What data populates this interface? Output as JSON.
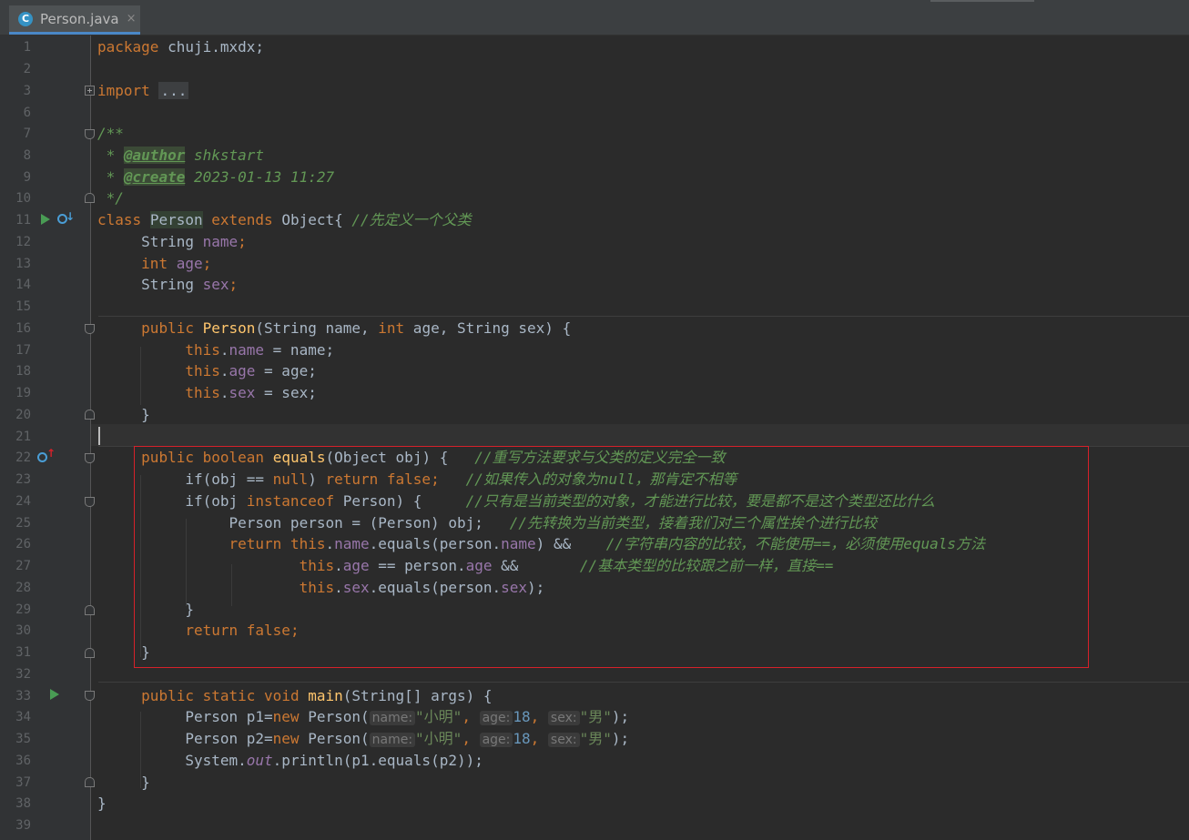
{
  "tab": {
    "title": "Person.java",
    "icon_letter": "C",
    "close_label": "×"
  },
  "colors": {
    "keyword": "#cc7832",
    "field": "#9876aa",
    "string": "#6a8759",
    "number": "#6897bb",
    "method": "#ffc66d",
    "comment": "#629755",
    "text": "#a9b7c6",
    "highlight_box": "#d6212a"
  },
  "icons": {
    "run": "run-triangle-icon",
    "override": "overridden-method-icon",
    "implements": "overriding-method-icon"
  },
  "line_numbers": [
    "1",
    "2",
    "3",
    "6",
    "7",
    "8",
    "9",
    "10",
    "11",
    "12",
    "13",
    "14",
    "15",
    "16",
    "17",
    "18",
    "19",
    "20",
    "21",
    "22",
    "23",
    "24",
    "25",
    "26",
    "27",
    "28",
    "29",
    "30",
    "31",
    "32",
    "33",
    "34",
    "35",
    "36",
    "37",
    "38",
    "39"
  ],
  "code": {
    "l1": {
      "kw": "package",
      "rest": " chuji.mxdx;"
    },
    "l3": {
      "kw": "import",
      "folded": "..."
    },
    "l7": {
      "c": "/**"
    },
    "l8": {
      "pre": " * ",
      "tag": "@author",
      "rest": " shkstart"
    },
    "l9": {
      "pre": " * ",
      "tag": "@create",
      "rest": " 2023-01-13 11:27"
    },
    "l10": {
      "c": " */"
    },
    "l11": {
      "kw1": "class",
      "name": "Person",
      "kw2": "extends",
      "rest": " Object{ ",
      "cmt": "//先定义一个父类"
    },
    "l12": {
      "type": "String",
      "field": "name",
      "end": ";"
    },
    "l13": {
      "type": "int",
      "field": "age",
      "end": ";"
    },
    "l14": {
      "type": "String",
      "field": "sex",
      "end": ";"
    },
    "l16": {
      "kw": "public",
      "fn": "Person",
      "p1": "(String name, ",
      "int": "int",
      "p2": " age, String sex) {"
    },
    "l17": {
      "this": "this",
      "dot": ".",
      "f": "name",
      "rest": " = name;"
    },
    "l18": {
      "this": "this",
      "dot": ".",
      "f": "age",
      "rest": " = age;"
    },
    "l19": {
      "this": "this",
      "dot": ".",
      "f": "sex",
      "rest": " = sex;"
    },
    "l20": {
      "t": "}"
    },
    "l22": {
      "kw1": "public",
      "kw2": "boolean",
      "fn": "equals",
      "rest": "(Object obj) {",
      "cmt": "//重写方法要求与父类的定义完全一致"
    },
    "l23": {
      "a": "if(obj == ",
      "null": "null",
      "b": ") ",
      "ret": "return",
      "false": "false",
      "end": ";",
      "cmt": "//如果传入的对象为null，那肯定不相等"
    },
    "l24": {
      "a": "if(obj ",
      "inst": "instanceof",
      "b": " Person) {",
      "cmt": "//只有是当前类型的对象，才能进行比较，要是都不是这个类型还比什么"
    },
    "l25": {
      "a": "Person person = (Person) obj;",
      "cmt": "//先转换为当前类型，接着我们对三个属性挨个进行比较"
    },
    "l26": {
      "ret": "return",
      "this": "this",
      "d1": ".",
      "f1": "name",
      "mid": ".equals(person.",
      "f2": "name",
      "end": ") &&",
      "cmt": "//字符串内容的比较，不能使用==，必须使用equals方法"
    },
    "l27": {
      "this": "this",
      "d1": ".",
      "f1": "age",
      "mid": " == person.",
      "f2": "age",
      "end": " &&",
      "cmt": "//基本类型的比较跟之前一样，直接=="
    },
    "l28": {
      "this": "this",
      "d1": ".",
      "f1": "sex",
      "mid": ".equals(person.",
      "f2": "sex",
      "end": ");"
    },
    "l29": {
      "t": "}"
    },
    "l30": {
      "ret": "return",
      "false": "false",
      "end": ";"
    },
    "l31": {
      "t": "}"
    },
    "l33": {
      "kw1": "public",
      "kw2": "static",
      "kw3": "void",
      "fn": "main",
      "rest": "(String[] args) {"
    },
    "l34": {
      "a": "Person p1=",
      "new": "new",
      "b": " Person(",
      "h1": "name:",
      "s1": "\"小明\"",
      "c1": ", ",
      "h2": "age:",
      "n": "18",
      "c2": ", ",
      "h3": "sex:",
      "s2": "\"男\"",
      "end": ");"
    },
    "l35": {
      "a": "Person p2=",
      "new": "new",
      "b": " Person(",
      "h1": "name:",
      "s1": "\"小明\"",
      "c1": ", ",
      "h2": "age:",
      "n": "18",
      "c2": ", ",
      "h3": "sex:",
      "s2": "\"男\"",
      "end": ");"
    },
    "l36": {
      "a": "System.",
      "out": "out",
      "b": ".println(p1.equals(p2));"
    },
    "l37": {
      "t": "}"
    },
    "l38": {
      "t": "}"
    }
  }
}
